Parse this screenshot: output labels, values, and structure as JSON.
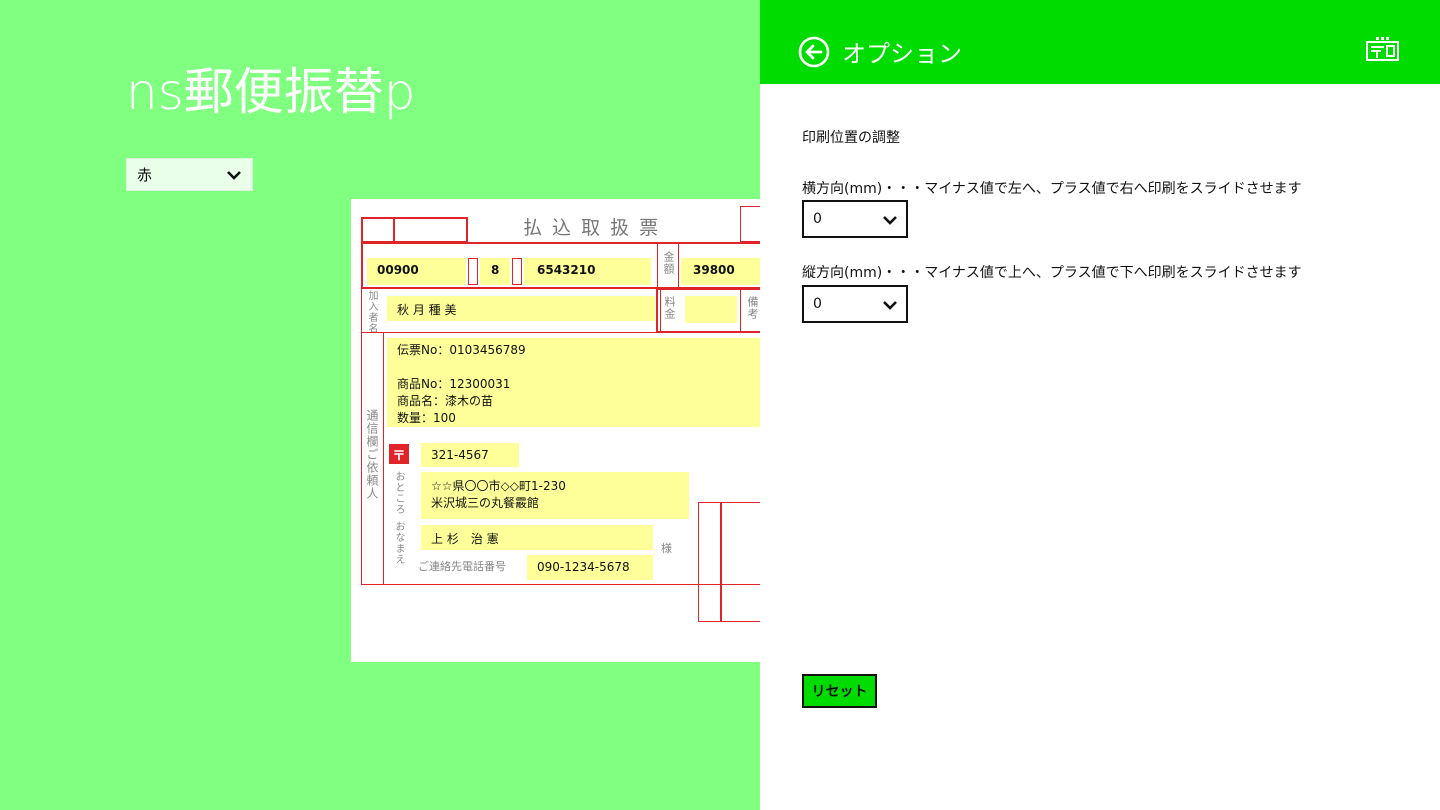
{
  "app": {
    "title": "ns郵便振替p"
  },
  "color_select": {
    "value": "赤"
  },
  "slip": {
    "title": "払 込 取 扱 票",
    "account_no_1": "00900",
    "check_digit": "8",
    "account_no_2": "6543210",
    "amount_label": "金額",
    "amount": "39800",
    "payee_label": "加入者名",
    "payee": "秋 月 種 美",
    "fee_label": "料金",
    "remarks_label": "備考",
    "memo_lines": [
      "伝票No：0103456789",
      "",
      "商品No：12300031",
      "商品名：漆木の苗",
      "数量：100"
    ],
    "memo_label": "通信欄ご依頼人",
    "postal_mark": "〒",
    "postal_code": "321-4567",
    "address_label": "おところ",
    "address_lines": [
      "☆☆県〇〇市◇◇町1-230",
      "米沢城三の丸餐霰館"
    ],
    "name_label": "おなまえ",
    "name": "上 杉　治 憲",
    "honorific": "様",
    "phone_label": "ご連絡先電話番号",
    "phone": "090-1234-5678"
  },
  "options_pane": {
    "title": "オプション",
    "section_title": "印刷位置の調整",
    "horizontal_label": "横方向(mm)・・・マイナス値で左へ、プラス値で右へ印刷をスライドさせます",
    "horizontal_value": "0",
    "vertical_label": "縦方向(mm)・・・マイナス値で上へ、プラス値で下へ印刷をスライドさせます",
    "vertical_value": "0",
    "reset_label": "リセット"
  },
  "colors": {
    "background": "#80ff80",
    "header": "#00dc00",
    "slip_red": "#e0242a",
    "slip_fill": "#ffff99"
  }
}
